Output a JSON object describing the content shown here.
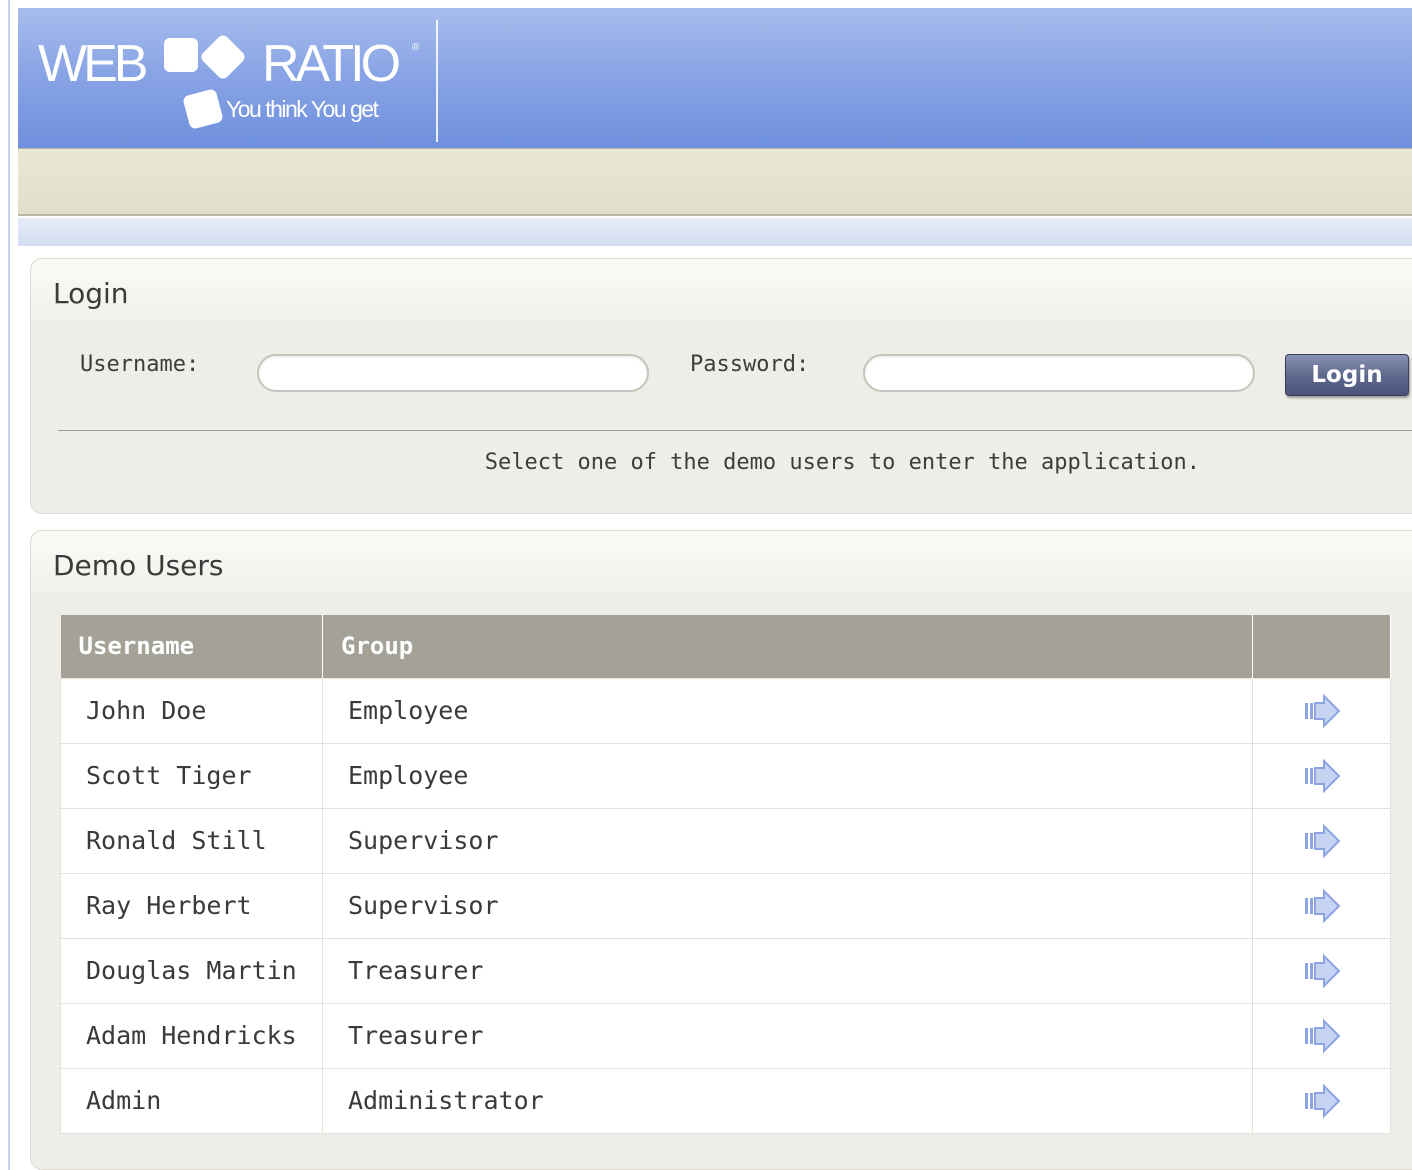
{
  "logo": {
    "brand_left": "WEB",
    "brand_right": "RATIO",
    "registered": "®",
    "tagline": "You think You get"
  },
  "login": {
    "title": "Login",
    "username_label": "Username:",
    "username_value": "",
    "password_label": "Password:",
    "password_value": "",
    "submit_label": "Login",
    "hint": "Select one of the demo users to enter the application."
  },
  "demo_users": {
    "title": "Demo Users",
    "columns": [
      "Username",
      "Group",
      ""
    ],
    "rows": [
      {
        "username": "John Doe",
        "group": "Employee",
        "action_icon": "right-arrow-icon"
      },
      {
        "username": "Scott Tiger",
        "group": "Employee",
        "action_icon": "right-arrow-icon"
      },
      {
        "username": "Ronald Still",
        "group": "Supervisor",
        "action_icon": "right-arrow-icon"
      },
      {
        "username": "Ray Herbert",
        "group": "Supervisor",
        "action_icon": "right-arrow-icon"
      },
      {
        "username": "Douglas Martin",
        "group": "Treasurer",
        "action_icon": "right-arrow-icon"
      },
      {
        "username": "Adam Hendricks",
        "group": "Treasurer",
        "action_icon": "right-arrow-icon"
      },
      {
        "username": "Admin",
        "group": "Administrator",
        "action_icon": "right-arrow-icon"
      }
    ]
  },
  "colors": {
    "header_top": "#a8bdec",
    "header_bottom": "#6e8fdc",
    "toolbar": "#e6e3d1",
    "table_header": "#a4a296",
    "arrow": "#8ea3e2",
    "button": "#5f6a8e"
  }
}
